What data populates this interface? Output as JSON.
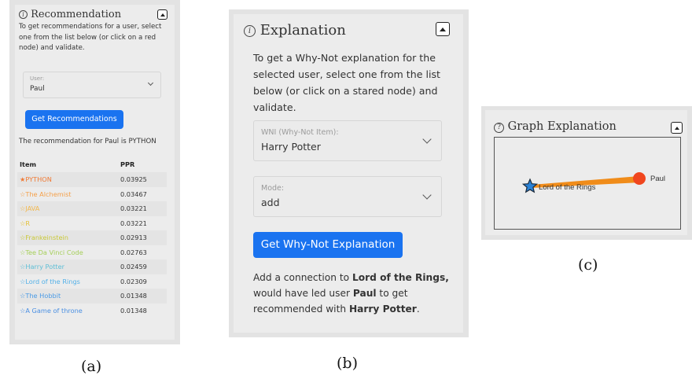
{
  "panel_a": {
    "title": "Recommendation",
    "description": "To get recommendations for a user, select one from the list below (or click on a red node) and validate.",
    "user_select": {
      "label": "User:",
      "value": "Paul"
    },
    "button_label": "Get Recommendations",
    "result_text": "The recommendation for Paul is PYTHON",
    "table": {
      "headers": [
        "Item",
        "PPR"
      ],
      "rows": [
        {
          "item": "★PYTHON",
          "ppr": "0.03925",
          "color": "#f07a34"
        },
        {
          "item": "☆The Alchemist",
          "ppr": "0.03467",
          "color": "#f5a04a"
        },
        {
          "item": "☆JAVA",
          "ppr": "0.03221",
          "color": "#f2b84e"
        },
        {
          "item": "☆R",
          "ppr": "0.03221",
          "color": "#e4c23a"
        },
        {
          "item": "☆Frankeinstein",
          "ppr": "0.02913",
          "color": "#c9c837"
        },
        {
          "item": "☆Tee Da Vinci Code",
          "ppr": "0.02763",
          "color": "#a6cf5a"
        },
        {
          "item": "☆Harry Potter",
          "ppr": "0.02459",
          "color": "#5fbfd6"
        },
        {
          "item": "☆Lord of the Rings",
          "ppr": "0.02309",
          "color": "#52b0e8"
        },
        {
          "item": "☆The Hobbit",
          "ppr": "0.01348",
          "color": "#4a9be6"
        },
        {
          "item": "☆A Game of throne",
          "ppr": "0.01348",
          "color": "#4a8fe2"
        }
      ]
    }
  },
  "panel_b": {
    "title": "Explanation",
    "description_lines": [
      "To get a Why-Not explanation for the",
      "selected user, select one from the list",
      "below (or click on a stared node) and",
      "validate."
    ],
    "wni_select": {
      "label": "WNI (Why-Not Item):",
      "value": "Harry Potter"
    },
    "mode_select": {
      "label": "Mode:",
      "value": "add"
    },
    "button_label": "Get Why-Not Explanation",
    "result": {
      "l1_pre": "Add a connection to ",
      "l1_bold": "Lord of the Rings,",
      "l2_pre": "would have led user ",
      "l2_bold": "Paul",
      "l2_post": " to get",
      "l3_pre": "recommended with ",
      "l3_bold": "Harry Potter",
      "l3_post": "."
    }
  },
  "panel_c": {
    "title": "Graph Explanation",
    "nodes": {
      "star_label": "Lord of the Rings",
      "user_label": "Paul"
    },
    "colors": {
      "edge": "#f08c1a",
      "user_node": "#f0461e",
      "star_node": "#2a82d6"
    }
  },
  "captions": {
    "a": "(a)",
    "b": "(b)",
    "c": "(c)"
  }
}
